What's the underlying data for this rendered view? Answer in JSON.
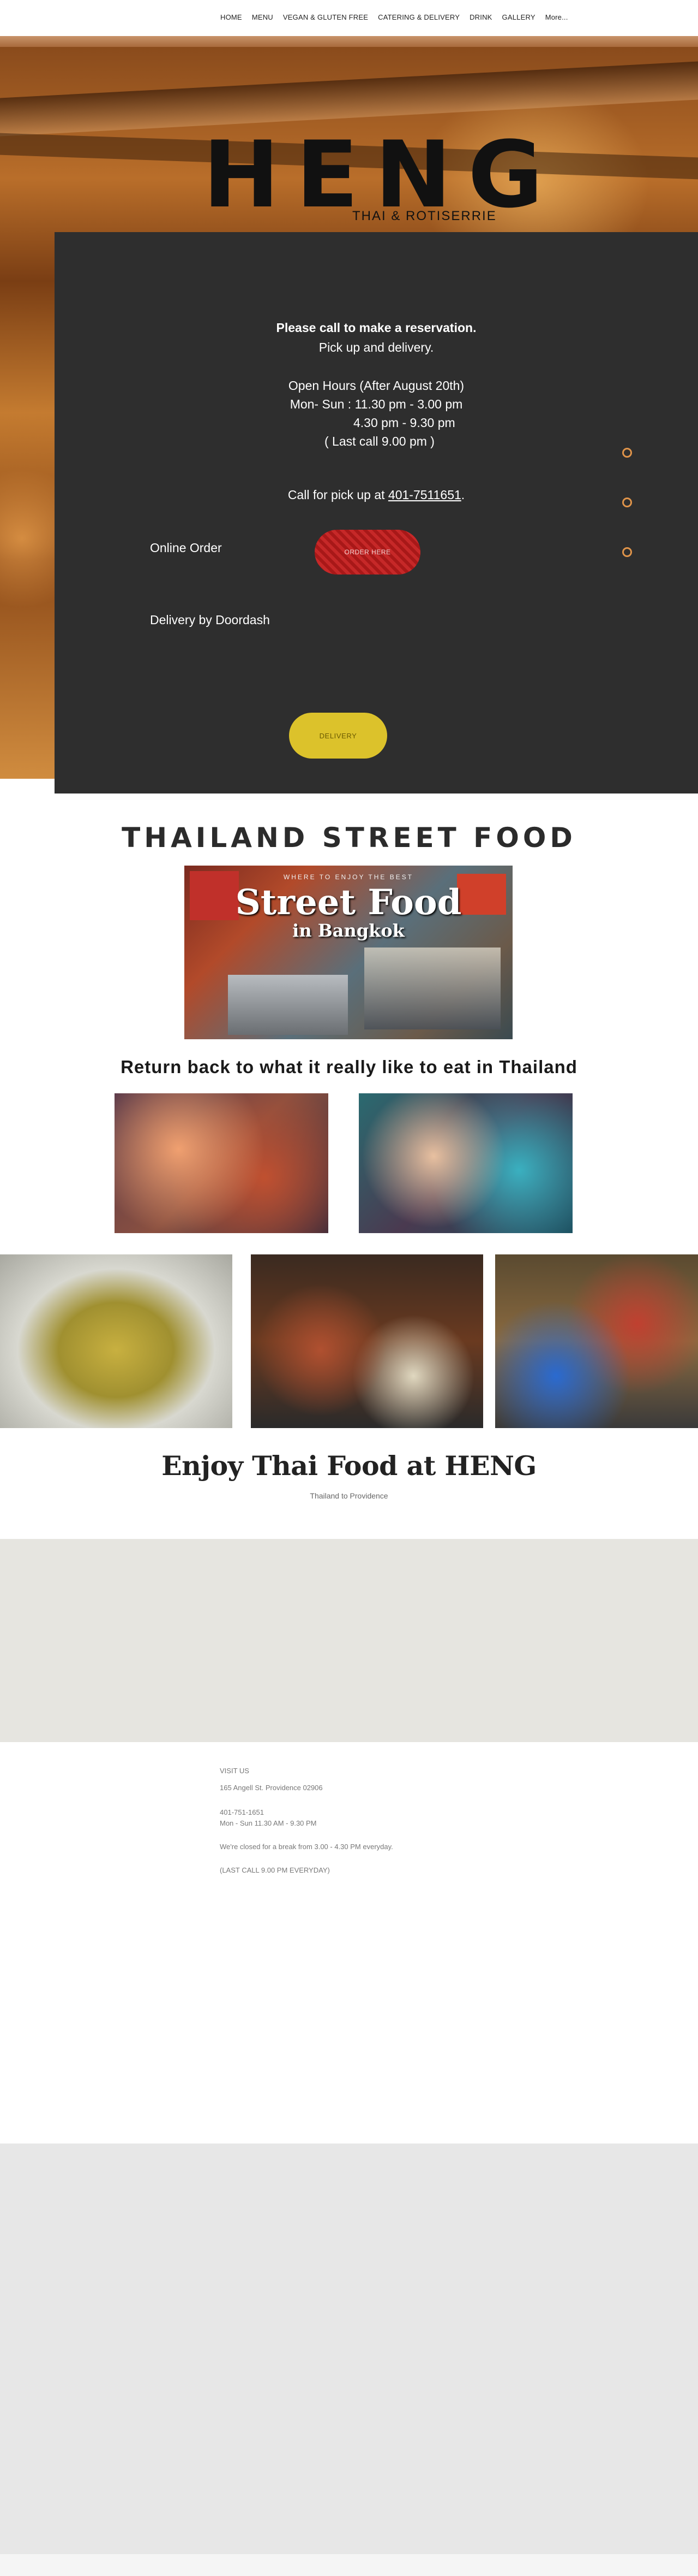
{
  "nav": {
    "items": [
      "HOME",
      "MENU",
      "VEGAN & GLUTEN FREE",
      "CATERING & DELIVERY",
      "DRINK",
      "GALLERY",
      "More..."
    ]
  },
  "hero": {
    "logo": "HENG",
    "logo_sub": "THAI & ROTISERRIE",
    "reservation": "Please call to make a reservation.",
    "pickup": "Pick up and delivery.",
    "hours_title": "Open Hours (After August 20th)",
    "hours_lunch": "Mon- Sun : 11.30 pm - 3.00 pm",
    "hours_dinner": "4.30 pm - 9.30 pm",
    "last_call": "( Last call 9.00 pm )",
    "call_prefix": "Call for pick up at ",
    "phone": "401-7511651",
    "call_suffix": ".",
    "online_order_label": "Online Order",
    "order_button": "ORDER HERE",
    "doordash_label": "Delivery by Doordash",
    "delivery_button": "DELIVERY",
    "slide_dots": 3
  },
  "street_food": {
    "title": "THAILAND STREET FOOD",
    "banner_small": "WHERE TO ENJOY THE BEST",
    "banner_big": "Street Food",
    "banner_city": "in Bangkok",
    "return_title": "Return back to what it really like to eat in Thailand"
  },
  "enjoy": {
    "title": "Enjoy Thai Food at HENG",
    "subtitle": "Thailand to Providence"
  },
  "visit": {
    "heading": "VISIT US",
    "address": "165 Angell St. Providence 02906",
    "phone": "401-751-1651",
    "hours": "Mon - Sun 11.30 AM - 9.30 PM",
    "break_note": "We're closed for a break from 3.00 - 4.30 PM everyday.",
    "last_call": "(LAST CALL 9.00 PM EVERYDAY)"
  },
  "colors": {
    "dark_panel": "#2e2e2e",
    "order_button": "#c62828",
    "delivery_button": "#dcc22b",
    "dot_accent": "#e0944a"
  }
}
